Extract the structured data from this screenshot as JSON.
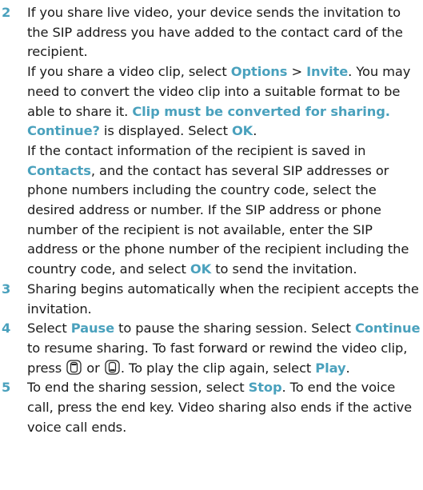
{
  "steps": [
    {
      "number": "2",
      "paragraphs": [
        [
          {
            "t": "If you share live video, your device sends the invitation to the SIP address you have added to the contact card of the recipient."
          }
        ],
        [
          {
            "t": "If you share a video clip, select "
          },
          {
            "t": "Options",
            "hl": true
          },
          {
            "t": " > "
          },
          {
            "t": "Invite",
            "hl": true
          },
          {
            "t": ". You may need to convert the video clip into a suitable format to be able to share it. "
          },
          {
            "t": "Clip must be converted for sharing. Continue?",
            "hl": true
          },
          {
            "t": " is displayed. Select "
          },
          {
            "t": "OK",
            "hl": true
          },
          {
            "t": "."
          }
        ],
        [
          {
            "t": "If the contact information of the recipient is saved in "
          },
          {
            "t": "Contacts",
            "hl": true
          },
          {
            "t": ", and the contact has several SIP addresses or phone numbers including the country code, select the desired address or number. If the SIP address or phone number of the recipient is not available, enter the SIP address or the phone number of the recipient including the country code, and select "
          },
          {
            "t": "OK",
            "hl": true
          },
          {
            "t": " to send the invitation."
          }
        ]
      ]
    },
    {
      "number": "3",
      "paragraphs": [
        [
          {
            "t": "Sharing begins automatically when the recipient accepts the invitation."
          }
        ]
      ]
    },
    {
      "number": "4",
      "paragraphs": [
        [
          {
            "t": "Select "
          },
          {
            "t": "Pause",
            "hl": true
          },
          {
            "t": " to pause the sharing session. Select "
          },
          {
            "t": "Continue",
            "hl": true
          },
          {
            "t": " to resume sharing. To fast forward or rewind the video clip, press "
          },
          {
            "icon": "scroll-up-key-icon"
          },
          {
            "t": " or "
          },
          {
            "icon": "scroll-down-key-icon"
          },
          {
            "t": ". To play the clip again, select "
          },
          {
            "t": "Play",
            "hl": true
          },
          {
            "t": "."
          }
        ]
      ]
    },
    {
      "number": "5",
      "paragraphs": [
        [
          {
            "t": "To end the sharing session, select "
          },
          {
            "t": "Stop",
            "hl": true
          },
          {
            "t": ". To end the voice call, press the end key. Video sharing also ends if the active voice call ends."
          }
        ]
      ]
    }
  ],
  "colors": {
    "highlight": "#4aa1bd",
    "text": "#1a1a1a"
  }
}
